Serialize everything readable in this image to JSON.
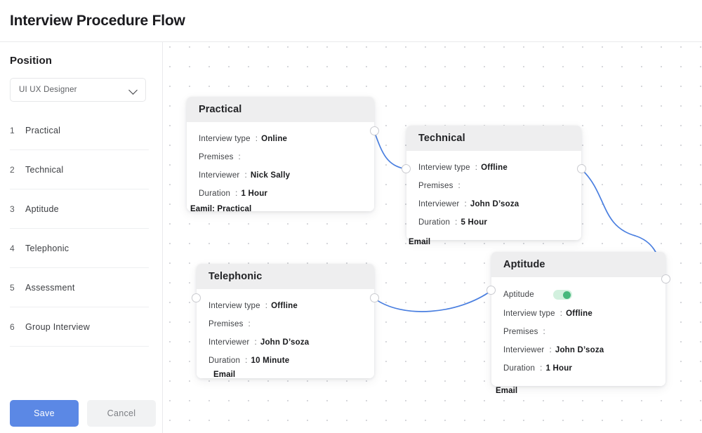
{
  "header": {
    "title": "Interview Procedure Flow"
  },
  "sidebar": {
    "position_label": "Position",
    "position_value": "UI UX Designer",
    "chevron_icon": "chevron-down-icon",
    "steps": [
      {
        "num": "1",
        "label": "Practical"
      },
      {
        "num": "2",
        "label": "Technical"
      },
      {
        "num": "3",
        "label": "Aptitude"
      },
      {
        "num": "4",
        "label": "Telephonic"
      },
      {
        "num": "5",
        "label": "Assessment"
      },
      {
        "num": "6",
        "label": "Group Interview"
      }
    ],
    "save_label": "Save",
    "cancel_label": "Cancel",
    "save_color": "#5b88e5",
    "cancel_color": "#f1f2f3"
  },
  "canvas": {
    "edge_color": "#4a7fe0",
    "handle_color": "#ffffff",
    "nodes": [
      {
        "title": "Practical",
        "email_tag": "Eamil: Practical",
        "rows": [
          {
            "k": "Interview type",
            "sep": ":",
            "v": "Online"
          },
          {
            "k": "Premises",
            "sep": ":",
            "v": ""
          },
          {
            "k": "Interviewer",
            "sep": ":",
            "v": "Nick Sally"
          },
          {
            "k": "Duration",
            "sep": ":",
            "v": "1 Hour"
          }
        ]
      },
      {
        "title": "Technical",
        "email_tag": "Email",
        "rows": [
          {
            "k": "Interview type",
            "sep": ":",
            "v": "Offline"
          },
          {
            "k": "Premises",
            "sep": ":",
            "v": ""
          },
          {
            "k": "Interviewer",
            "sep": ":",
            "v": "John D’soza"
          },
          {
            "k": "Duration",
            "sep": ":",
            "v": "5 Hour"
          }
        ]
      },
      {
        "title": "Telephonic",
        "email_tag": "Email",
        "rows": [
          {
            "k": "Interview type",
            "sep": ":",
            "v": "Offline"
          },
          {
            "k": "Premises",
            "sep": ":",
            "v": ""
          },
          {
            "k": "Interviewer",
            "sep": ":",
            "v": "John D’soza"
          },
          {
            "k": "Duration",
            "sep": ":",
            "v": "10 Minute"
          }
        ]
      },
      {
        "title": "Aptitude",
        "email_tag": "Email",
        "toggle_label": "Aptitude",
        "toggle_state": "on",
        "toggle_track_color": "#d2f0de",
        "toggle_knob_color": "#47b87c",
        "rows": [
          {
            "k": "Interview type",
            "sep": ":",
            "v": "Offline"
          },
          {
            "k": "Premises",
            "sep": ":",
            "v": ""
          },
          {
            "k": "Interviewer",
            "sep": ":",
            "v": "John D’soza"
          },
          {
            "k": "Duration",
            "sep": ":",
            "v": "1 Hour"
          }
        ]
      }
    ]
  }
}
